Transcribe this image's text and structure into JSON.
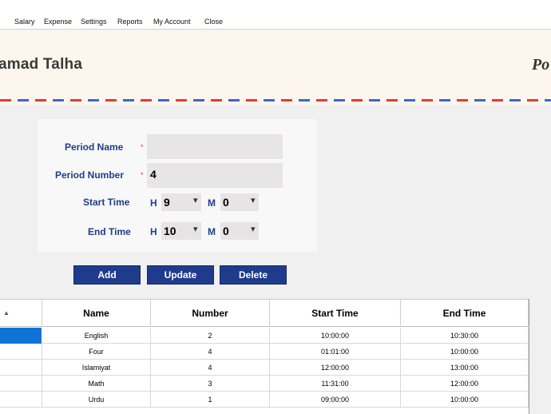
{
  "menu": [
    "Salary",
    "Expense",
    "Settings",
    "Reports",
    "My Account",
    "Close"
  ],
  "header": {
    "name": "amad Talha",
    "script_text": "Po"
  },
  "form": {
    "period_name_label": "Period Name",
    "period_number_label": "Period Number",
    "start_time_label": "Start Time",
    "end_time_label": "End Time",
    "required_mark": "*",
    "period_name_value": "",
    "period_number_value": "4",
    "hour_label": "H",
    "minute_label": "M",
    "start_hour": "9",
    "start_minute": "0",
    "end_hour": "10",
    "end_minute": "0",
    "spin_arrow": "▾"
  },
  "buttons": {
    "add": "Add",
    "update": "Update",
    "delete": "Delete"
  },
  "grid": {
    "sort_indicator": "▲",
    "columns": [
      "Name",
      "Number",
      "Start Time",
      "End Time"
    ],
    "rows": [
      {
        "name": "English",
        "number": "2",
        "start": "10:00:00",
        "end": "10:30:00"
      },
      {
        "name": "Four",
        "number": "4",
        "start": "01:01:00",
        "end": "10:00:00"
      },
      {
        "name": "Islamiyat",
        "number": "4",
        "start": "12:00:00",
        "end": "13:00:00"
      },
      {
        "name": "Math",
        "number": "3",
        "start": "11:31:00",
        "end": "12:00:00"
      },
      {
        "name": "Urdu",
        "number": "1",
        "start": "09:00:00",
        "end": "10:00:00"
      }
    ]
  },
  "colors": {
    "accent": "#1f3c8c",
    "selection": "#1172d6",
    "header_bg": "#fdf6ee",
    "stripe_red": "#e03b3b",
    "stripe_blue": "#3f66c8"
  }
}
